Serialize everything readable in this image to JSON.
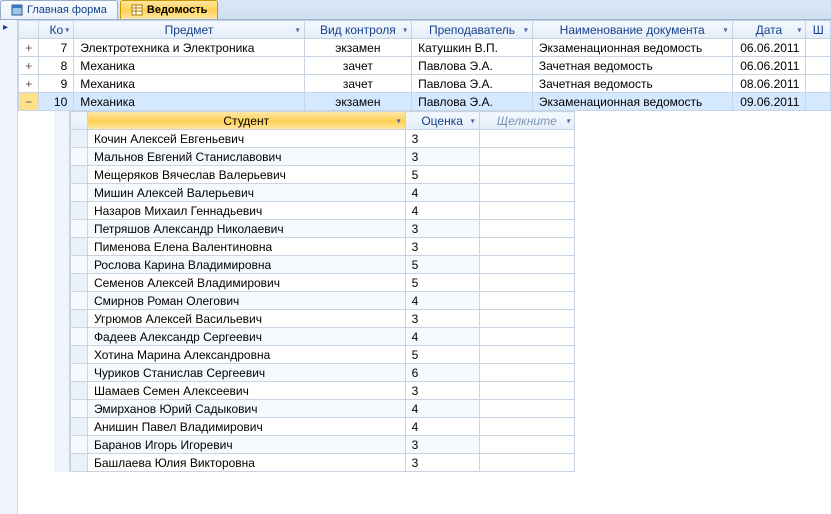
{
  "tabs": [
    {
      "label": "Главная форма",
      "active": false
    },
    {
      "label": "Ведомость",
      "active": true
    }
  ],
  "main_columns": {
    "code": "Ко",
    "subject": "Предмет",
    "control": "Вид контроля",
    "teacher": "Преподаватель",
    "docname": "Наименование документа",
    "date": "Дата",
    "extra": "Ш"
  },
  "main_rows": [
    {
      "exp": "+",
      "code": "7",
      "subject": "Электротехника и Электроника",
      "control": "экзамен",
      "teacher": "Катушкин В.П.",
      "docname": "Экзаменационная ведомость",
      "date": "06.06.2011",
      "selected": false
    },
    {
      "exp": "+",
      "code": "8",
      "subject": "Механика",
      "control": "зачет",
      "teacher": "Павлова Э.А.",
      "docname": "Зачетная ведомость",
      "date": "06.06.2011",
      "selected": false
    },
    {
      "exp": "+",
      "code": "9",
      "subject": "Механика",
      "control": "зачет",
      "teacher": "Павлова Э.А.",
      "docname": "Зачетная ведомость",
      "date": "08.06.2011",
      "selected": false
    },
    {
      "exp": "−",
      "code": "10",
      "subject": "Механика",
      "control": "экзамен",
      "teacher": "Павлова Э.А.",
      "docname": "Экзаменационная ведомость",
      "date": "09.06.2011",
      "selected": true
    }
  ],
  "sub_columns": {
    "student": "Студент",
    "grade": "Оценка",
    "click": "Щелкните"
  },
  "sub_rows": [
    {
      "student": "Кочин Алексей Евгеньевич",
      "grade": "3"
    },
    {
      "student": "Мальнов Евгений Станиславович",
      "grade": "3"
    },
    {
      "student": "Мещеряков Вячеслав Валерьевич",
      "grade": "5"
    },
    {
      "student": "Мишин Алексей Валерьевич",
      "grade": "4"
    },
    {
      "student": "Назаров Михаил Геннадьевич",
      "grade": "4"
    },
    {
      "student": "Петряшов Александр Николаевич",
      "grade": "3"
    },
    {
      "student": "Пименова Елена Валентиновна",
      "grade": "3"
    },
    {
      "student": "Рослова Карина Владимировна",
      "grade": "5"
    },
    {
      "student": "Семенов Алексей Владимирович",
      "grade": "5"
    },
    {
      "student": "Смирнов Роман Олегович",
      "grade": "4"
    },
    {
      "student": "Угрюмов Алексей Васильевич",
      "grade": "3"
    },
    {
      "student": "Фадеев Александр Сергеевич",
      "grade": "4"
    },
    {
      "student": "Хотина Марина Александровна",
      "grade": "5"
    },
    {
      "student": "Чуриков Станислав Сергеевич",
      "grade": "6"
    },
    {
      "student": "Шамаев Семен Алексеевич",
      "grade": "3"
    },
    {
      "student": "Эмирханов Юрий Садыкович",
      "grade": "4"
    },
    {
      "student": "Анишин Павел Владимирович",
      "grade": "4"
    },
    {
      "student": "Баранов Игорь Игоревич",
      "grade": "3"
    },
    {
      "student": "Башлаева Юлия Викторовна",
      "grade": "3"
    }
  ]
}
